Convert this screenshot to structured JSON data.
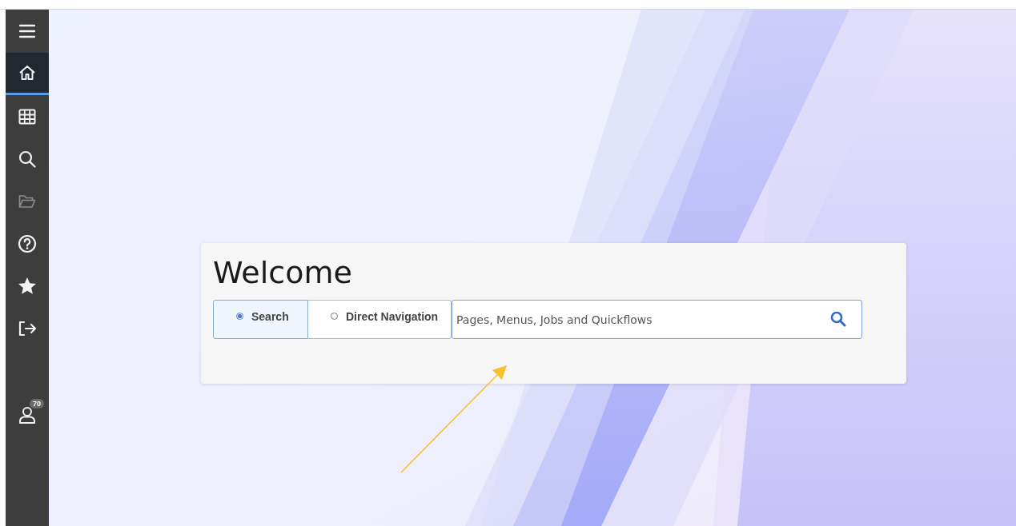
{
  "sidebar": {
    "items": [
      {
        "kind": "menu",
        "selected": false,
        "disabled": false
      },
      {
        "kind": "home",
        "selected": true,
        "disabled": false
      },
      {
        "kind": "grid",
        "selected": false,
        "disabled": false
      },
      {
        "kind": "search",
        "selected": false,
        "disabled": false
      },
      {
        "kind": "folder",
        "selected": false,
        "disabled": true
      },
      {
        "kind": "help",
        "selected": false,
        "disabled": false
      },
      {
        "kind": "star",
        "selected": false,
        "disabled": false
      },
      {
        "kind": "signout",
        "selected": false,
        "disabled": false
      },
      {
        "kind": "user",
        "selected": false,
        "disabled": false,
        "badge": "70"
      }
    ]
  },
  "welcome": {
    "title": "Welcome",
    "modes": [
      {
        "label": "Search",
        "selected": true
      },
      {
        "label": "Direct Navigation",
        "selected": false
      }
    ],
    "search": {
      "placeholder": "Pages, Menus, Jobs and Quickflows"
    }
  }
}
